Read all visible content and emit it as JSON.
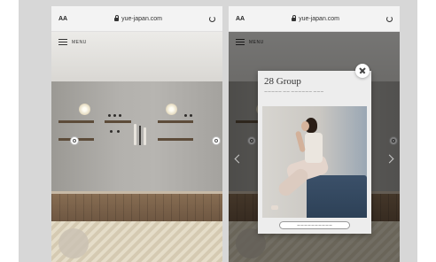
{
  "browser": {
    "aa_label": "AA",
    "url": "yue-japan.com"
  },
  "menu": {
    "label": "MENU"
  },
  "modal": {
    "title": "28 Group",
    "subtitle": "ーーーーー ーー ーーーーーー ーーー",
    "button_label": "ーーーーーーーーーー"
  },
  "colors": {
    "background": "#d7d7d7",
    "wall": "#b3b1ad",
    "counter": "#7a624b",
    "sofa": "#34485f"
  }
}
